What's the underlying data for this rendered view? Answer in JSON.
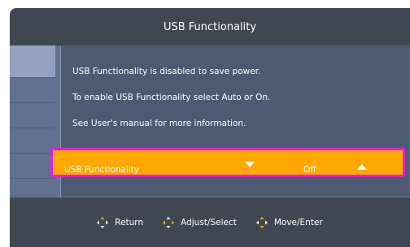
{
  "title": "USB Functionality",
  "messages": [
    "USB Functionality is disabled to save power.",
    "To enable USB Functionality select Auto or On.",
    "See User's manual for more information."
  ],
  "setting": {
    "label": "USB Functionality",
    "value": "Off"
  },
  "footer": {
    "hints": [
      {
        "icon": "dpad-icon",
        "label": "Return"
      },
      {
        "icon": "dpad-icon",
        "label": "Adjust/Select"
      },
      {
        "icon": "dpad-icon",
        "label": "Move/Enter"
      }
    ]
  },
  "colors": {
    "panel_dark": "#3f4852",
    "content_bg": "#4c5b71",
    "sidebar_bg": "#5f7290",
    "sidebar_active": "#92a2c0",
    "highlight": "#ffa800",
    "highlight_border": "#e01ee8",
    "icon_accent": "#ffb000"
  }
}
